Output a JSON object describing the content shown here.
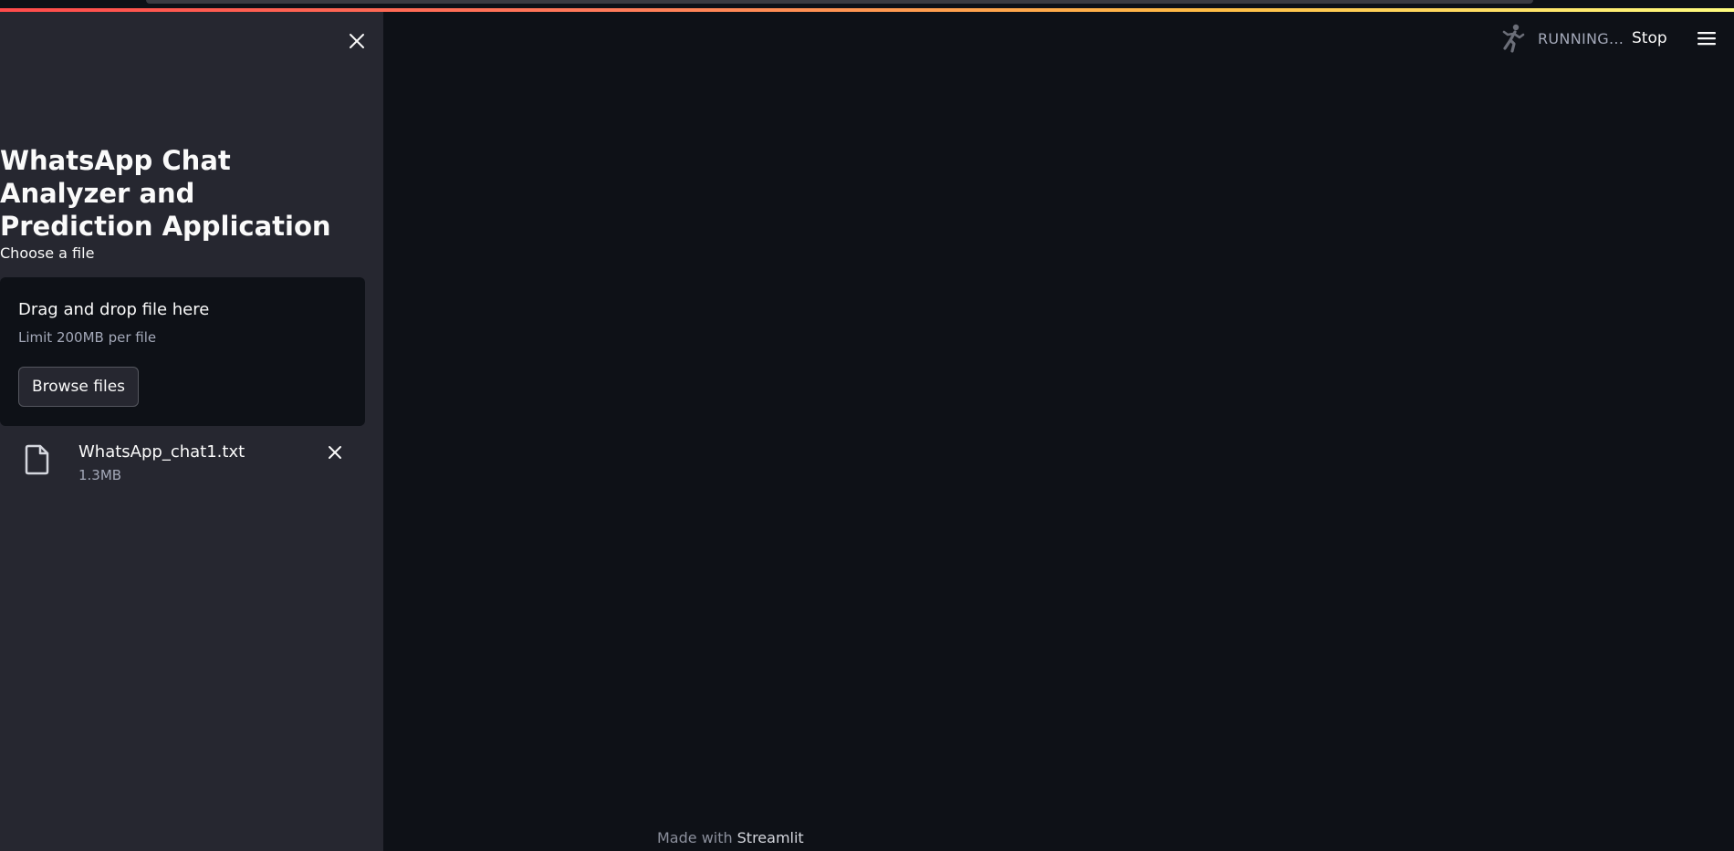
{
  "app": {
    "title": "WhatsApp Chat Analyzer and Prediction Application"
  },
  "uploader": {
    "label": "Choose a file",
    "dropzone_text": "Drag and drop file here",
    "limit_text": "Limit 200MB per file",
    "browse_label": "Browse files"
  },
  "uploaded_file": {
    "name": "WhatsApp_chat1.txt",
    "size": "1.3MB"
  },
  "header": {
    "status_text": "RUNNING...",
    "stop_label": "Stop"
  },
  "footer": {
    "made_with": "Made with",
    "brand": "Streamlit"
  },
  "icons": {
    "sidebar_close": "close-icon",
    "file": "file-icon",
    "file_remove": "close-icon",
    "running": "running-person-icon",
    "menu": "hamburger-menu-icon"
  },
  "colors": {
    "main_background": "#0e1117",
    "sidebar_background": "#262730",
    "decoration_start": "#ff4b4b",
    "decoration_end": "#fffd80"
  }
}
